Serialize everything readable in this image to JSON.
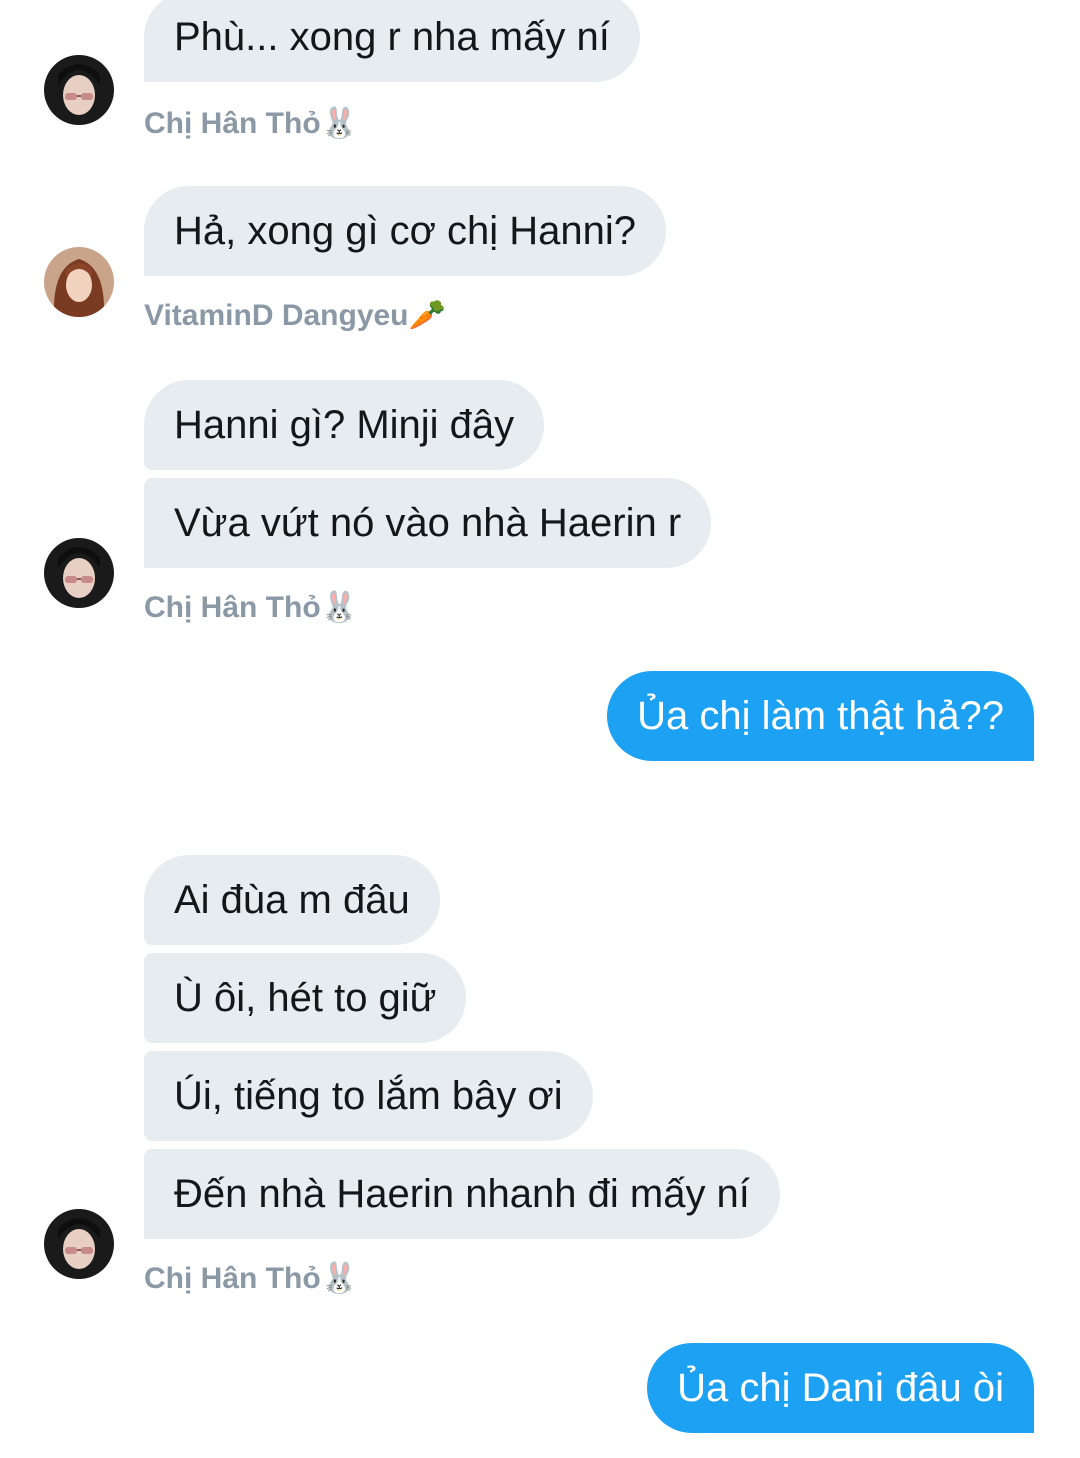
{
  "messages": {
    "m1": "Phù... xong r nha mấy ní",
    "m2": "Hả, xong gì cơ chị Hanni?",
    "m3": "Hanni gì? Minji đây",
    "m4": "Vừa vứt nó vào nhà Haerin r",
    "m5": "Ủa chị làm thật hả??",
    "m6": "Ai đùa m đâu",
    "m7": "Ù ôi, hét to giữ",
    "m8": "Úi, tiếng to lắm bây ơi",
    "m9": "Đến nhà Haerin nhanh đi mấy ní",
    "m10": "Ủa chị Dani đâu òi"
  },
  "senders": {
    "han": "Chị Hân Thỏ🐰",
    "vitamin": "VitaminD Dangyeu🥕"
  },
  "colors": {
    "incoming_bubble": "#e6ecf0",
    "outgoing_bubble": "#1da1f2",
    "sender_name": "#8b98a5"
  }
}
